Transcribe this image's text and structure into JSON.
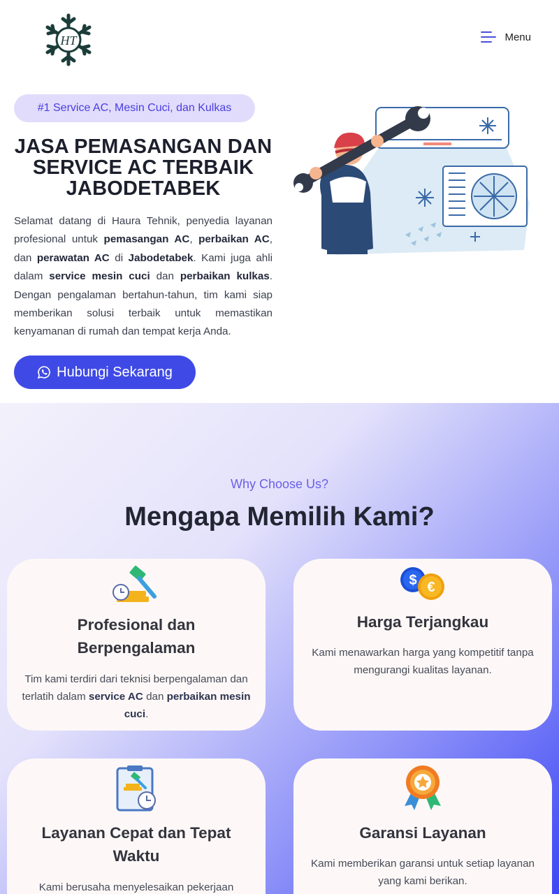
{
  "header": {
    "logo_alt": "HT",
    "menu_label": "Menu"
  },
  "hero": {
    "badge": "#1 Service AC, Mesin Cuci, dan Kulkas",
    "title": "JASA PEMASANGAN DAN SERVICE AC TERBAIK JABODETABEK",
    "desc": {
      "p1": "Selamat datang di Haura Tehnik, penyedia layanan profesional untuk ",
      "b1": "pemasangan AC",
      "p2": ", ",
      "b2": "perbaikan AC",
      "p3": ", dan ",
      "b3": "perawatan AC",
      "p4": " di ",
      "b4": "Jabodetabek",
      "p5": ". Kami juga ahli dalam ",
      "b5": "service mesin cuci",
      "p6": " dan ",
      "b6": "perbaikan kulkas",
      "p7": ". Dengan pengalaman bertahun-tahun, tim kami siap memberikan solusi terbaik untuk memastikan kenyamanan di rumah dan tempat kerja Anda."
    },
    "cta_label": "Hubungi Sekarang",
    "cta_icon": "whatsapp-icon"
  },
  "why": {
    "kicker": "Why Choose Us?",
    "title": "Mengapa Memilih Kami?",
    "cards": [
      {
        "icon": "gavel-clock-icon",
        "title": "Profesional dan Berpengalaman",
        "text_a": "Tim kami terdiri dari teknisi berpengalaman dan terlatih dalam ",
        "bold_a": "service AC",
        "text_b": " dan ",
        "bold_b": "perbaikan mesin cuci",
        "text_c": "."
      },
      {
        "icon": "currency-coins-icon",
        "title": "Harga Terjangkau",
        "text": "Kami menawarkan harga yang kompetitif tanpa mengurangi kualitas layanan."
      },
      {
        "icon": "clipboard-clock-icon",
        "title": "Layanan Cepat dan Tepat Waktu",
        "text": "Kami berusaha menyelesaikan pekerjaan"
      },
      {
        "icon": "award-medal-icon",
        "title": "Garansi Layanan",
        "text": "Kami memberikan garansi untuk setiap layanan yang kami berikan."
      }
    ]
  },
  "colors": {
    "accent": "#3f4ae6",
    "badge_bg": "#e1dcfb",
    "card_bg": "#fdf8f7"
  }
}
